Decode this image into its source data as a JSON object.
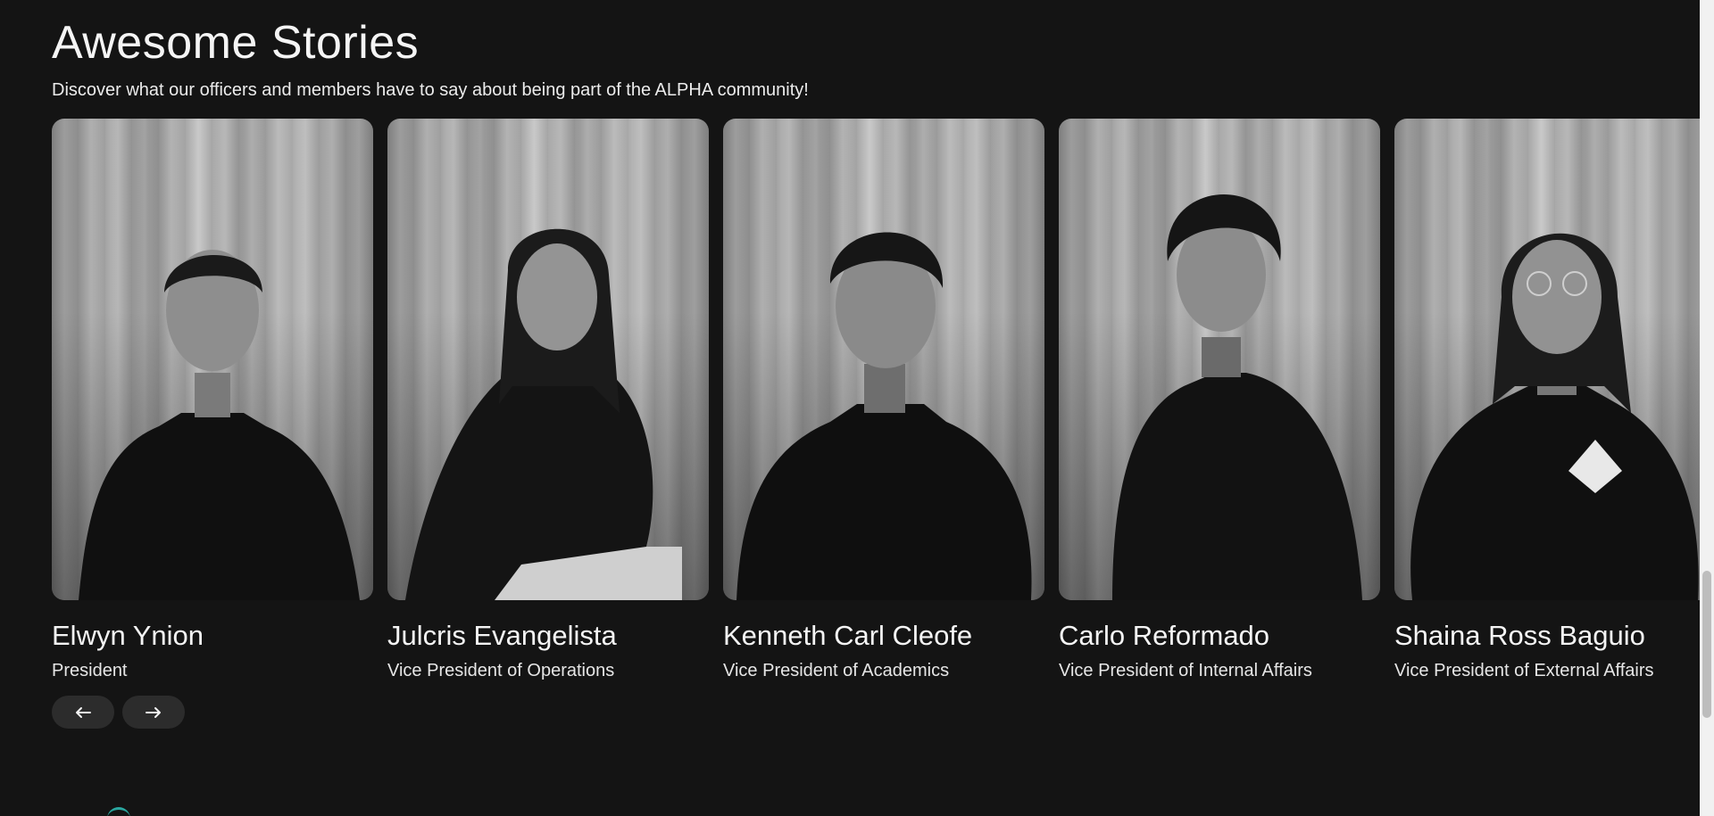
{
  "section": {
    "title": "Awesome Stories",
    "subtitle": "Discover what our officers and members have to say about being part of the ALPHA community!"
  },
  "members": [
    {
      "name": "Elwyn Ynion",
      "role": "President"
    },
    {
      "name": "Julcris Evangelista",
      "role": "Vice President of Operations"
    },
    {
      "name": "Kenneth Carl Cleofe",
      "role": "Vice President of Academics"
    },
    {
      "name": "Carlo Reformado",
      "role": "Vice President of Internal Affairs"
    },
    {
      "name": "Shaina Ross Baguio",
      "role": "Vice President of External Affairs"
    }
  ],
  "controls": {
    "prev_icon": "arrow-left-icon",
    "next_icon": "arrow-right-icon"
  },
  "colors": {
    "background": "#141414",
    "button": "#2c2c2c",
    "accent": "#2aa7a0"
  }
}
